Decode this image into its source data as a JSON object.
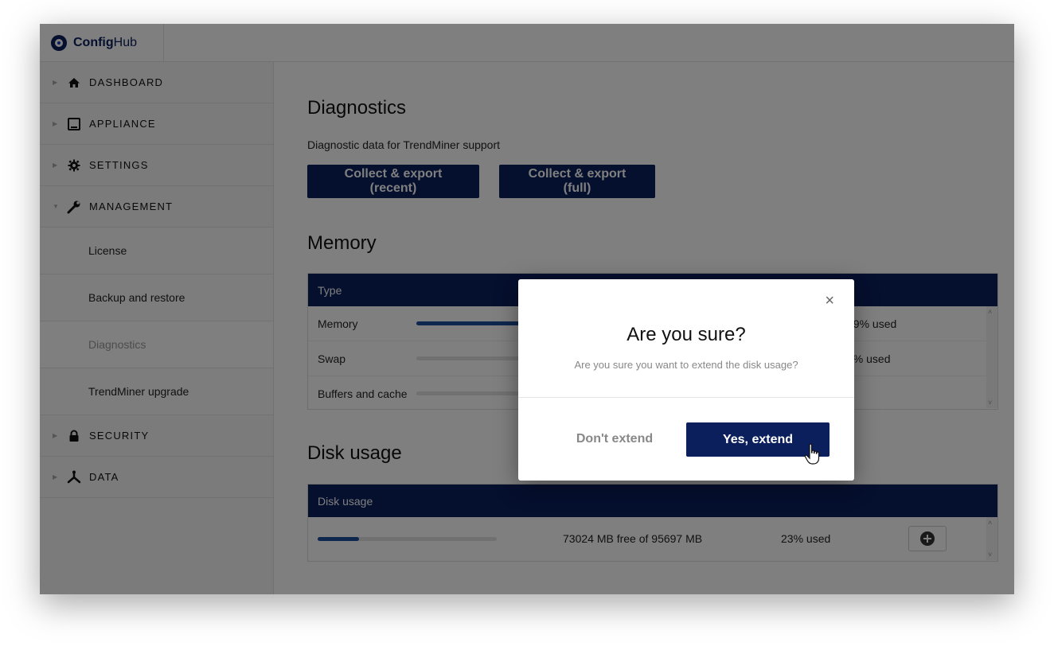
{
  "app": {
    "brand_part1": "Config",
    "brand_part2": "Hub"
  },
  "sidebar": {
    "items": [
      {
        "label": "DASHBOARD",
        "icon": "home-icon"
      },
      {
        "label": "APPLIANCE",
        "icon": "monitor-icon"
      },
      {
        "label": "SETTINGS",
        "icon": "gear-icon"
      },
      {
        "label": "MANAGEMENT",
        "icon": "wrench-icon"
      },
      {
        "label": "SECURITY",
        "icon": "lock-icon"
      },
      {
        "label": "DATA",
        "icon": "network-icon"
      }
    ],
    "management_subitems": [
      {
        "label": "License"
      },
      {
        "label": "Backup and restore"
      },
      {
        "label": "Diagnostics"
      },
      {
        "label": "TrendMiner upgrade"
      }
    ]
  },
  "diagnostics": {
    "title": "Diagnostics",
    "description": "Diagnostic data for TrendMiner support",
    "btn_recent": "Collect & export (recent)",
    "btn_full": "Collect & export (full)"
  },
  "memory": {
    "title": "Memory",
    "header_type": "Type",
    "rows": [
      {
        "label": "Memory",
        "fill": 0.99,
        "pct": "99% used"
      },
      {
        "label": "Swap",
        "fill": 0.0,
        "pct": "0% used"
      },
      {
        "label": "Buffers and cache",
        "fill": 0.0,
        "pct": ""
      }
    ]
  },
  "disk": {
    "title": "Disk usage",
    "header": "Disk usage",
    "row": {
      "fill": 0.23,
      "free_text": "73024 MB free of 95697 MB",
      "pct": "23% used"
    }
  },
  "modal": {
    "close_symbol": "×",
    "title": "Are you sure?",
    "text": "Are you sure you want to extend the disk usage?",
    "cancel_label": "Don't extend",
    "confirm_label": "Yes, extend"
  },
  "colors": {
    "navy": "#0a1f5c",
    "bar": "#1d4f9c"
  }
}
